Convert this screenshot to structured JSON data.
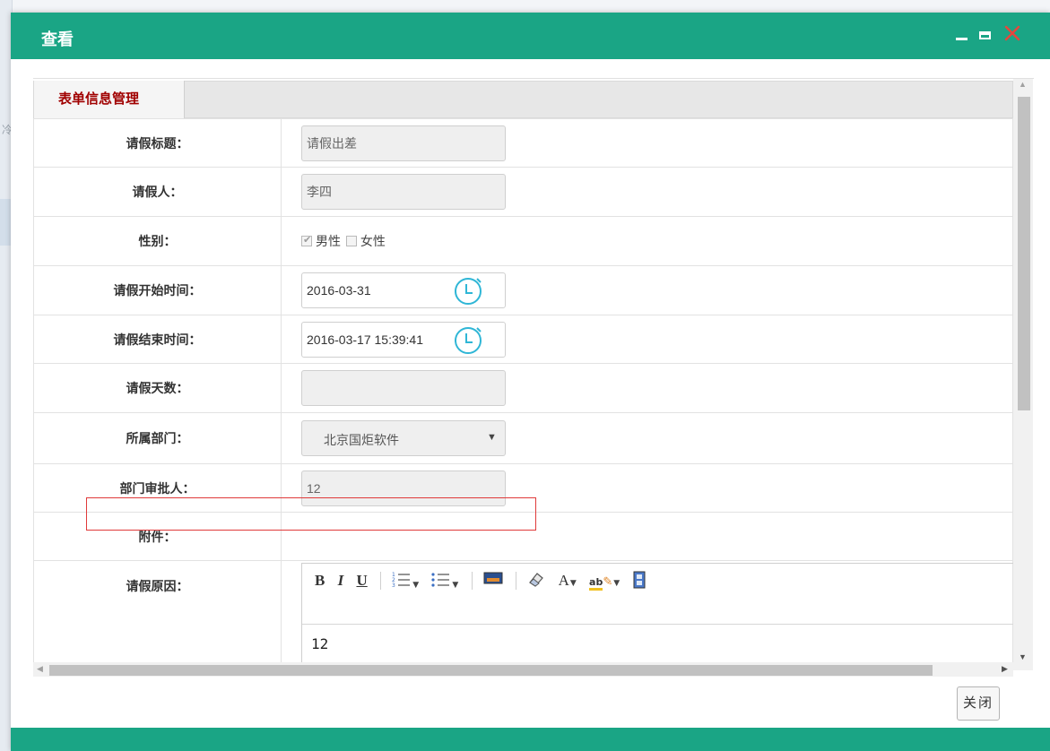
{
  "dialog": {
    "title": "查看",
    "controls": [
      "minimize-icon",
      "maximize-icon",
      "close-icon"
    ],
    "accent_color": "#1aa585"
  },
  "background": {
    "fragment_text": "冷"
  },
  "tab": {
    "label": "表单信息管理"
  },
  "form": {
    "title": {
      "label": "请假标题：",
      "value": "请假出差"
    },
    "person": {
      "label": "请假人：",
      "value": "李四"
    },
    "gender": {
      "label": "性别：",
      "options": [
        "男性",
        "女性"
      ],
      "selected": "男性"
    },
    "start_time": {
      "label": "请假开始时间：",
      "value": "2016-03-31"
    },
    "end_time": {
      "label": "请假结束时间：",
      "value": "2016-03-17 15:39:41"
    },
    "days": {
      "label": "请假天数：",
      "value": ""
    },
    "department": {
      "label": "所属部门：",
      "value": "北京国炬软件"
    },
    "approver": {
      "label": "部门审批人：",
      "value": "12"
    },
    "attachment": {
      "label": "附件："
    },
    "reason": {
      "label": "请假原因：",
      "toolbar": {
        "bold": "B",
        "italic": "I",
        "underline": "U",
        "font_color": "A",
        "highlight": "ab"
      },
      "content": "12"
    }
  },
  "buttons": {
    "close_label": "关闭"
  },
  "highlight_color": "#e03a3a"
}
